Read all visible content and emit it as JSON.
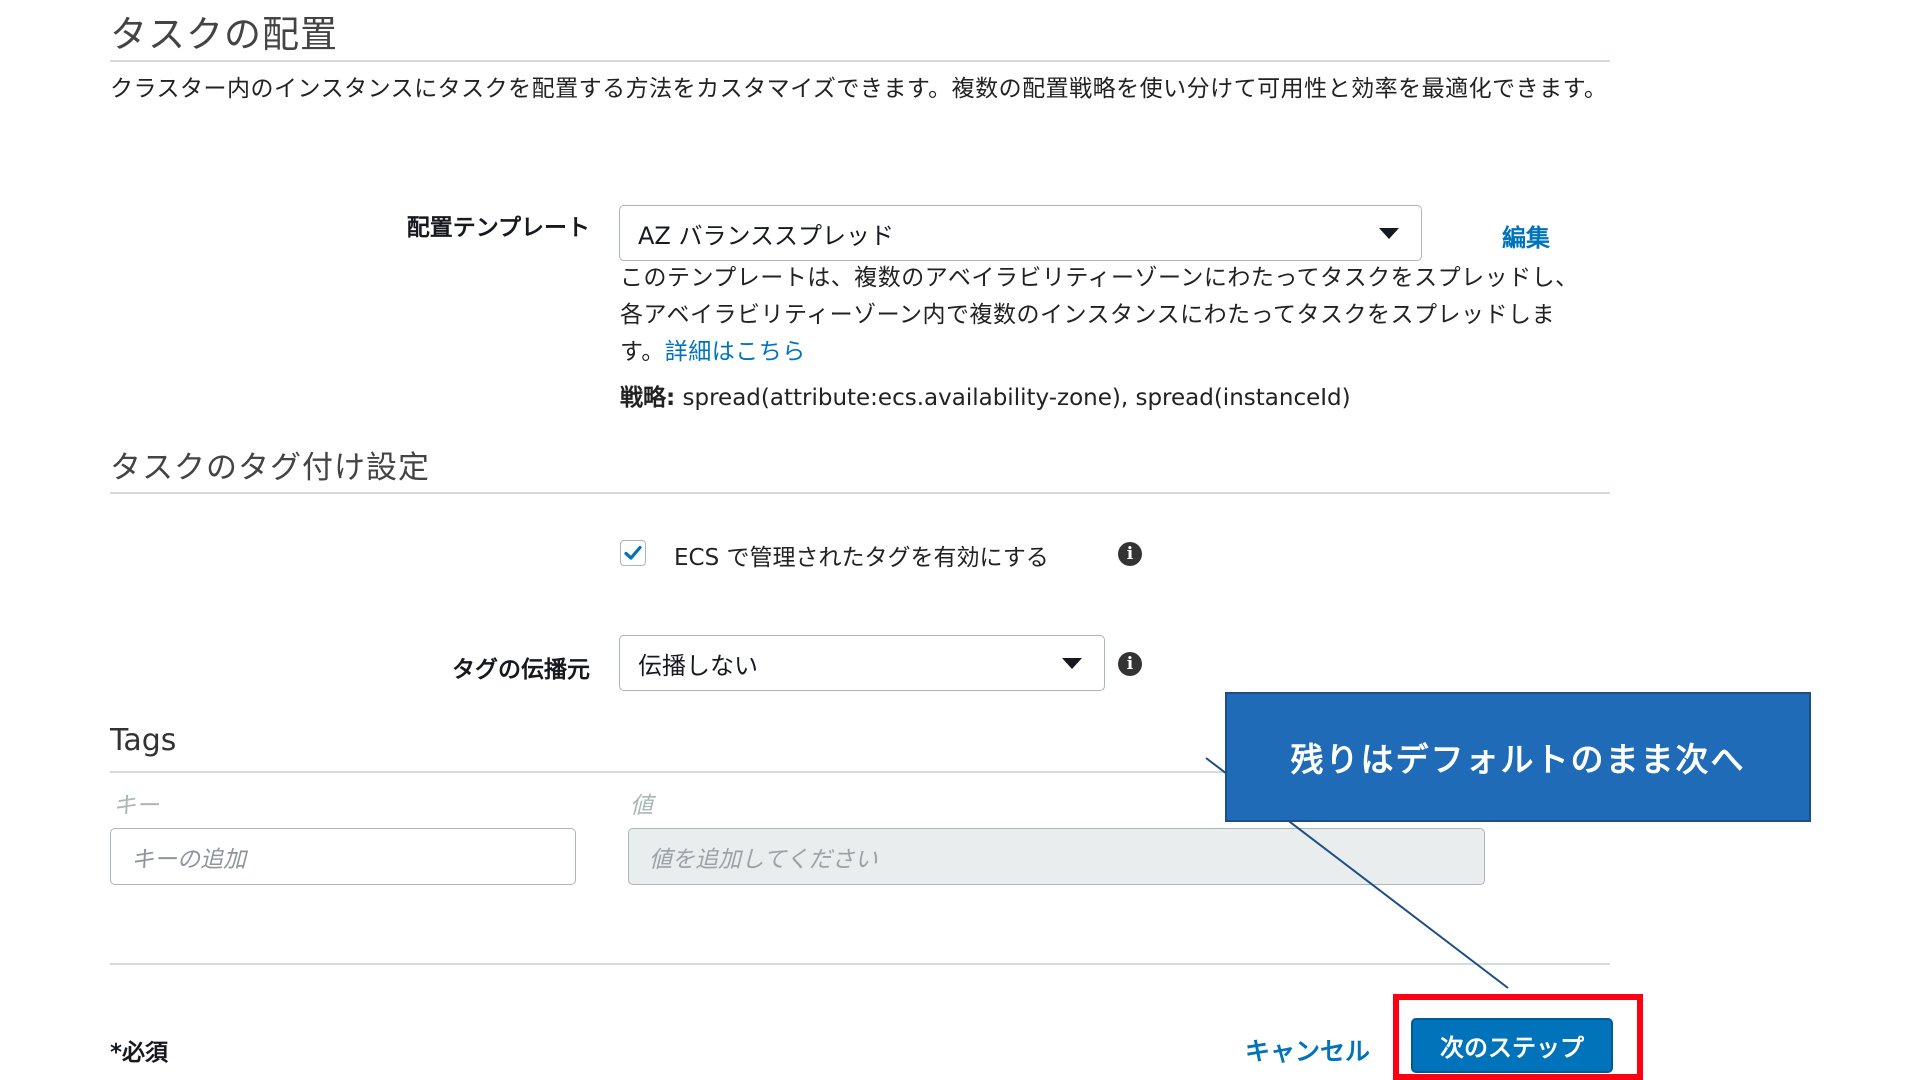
{
  "placement": {
    "title": "タスクの配置",
    "description": "クラスター内のインスタンスにタスクを配置する方法をカスタマイズできます。複数の配置戦略を使い分けて可用性と効率を最適化できます。",
    "template_label": "配置テンプレート",
    "template_value": "AZ バランススプレッド",
    "edit_link": "編集",
    "help_text": "このテンプレートは、複数のアベイラビリティーゾーンにわたってタスクをスプレッドし、各アベイラビリティーゾーン内で複数のインスタンスにわたってタスクをスプレッドします。",
    "learn_more_link": "詳細はこちら",
    "strategy_label": "戦略:",
    "strategy_value": " spread(attribute:ecs.availability-zone), spread(instanceId)"
  },
  "tagging": {
    "title": "タスクのタグ付け設定",
    "ecs_managed_tags_label": "ECS で管理されたタグを有効にする",
    "ecs_managed_tags_checked": true,
    "propagate_label": "タグの伝播元",
    "propagate_value": "伝播しない"
  },
  "tags": {
    "title": "Tags",
    "key_header": "キー",
    "value_header": "値",
    "key_placeholder": "キーの追加",
    "value_placeholder": "値を追加してください"
  },
  "footer": {
    "required_note": "*必須",
    "cancel_label": "キャンセル",
    "next_label": "次のステップ"
  },
  "annotation": {
    "callout_text": "残りはデフォルトのまま次へ",
    "callout_color": "#1f6bb7",
    "highlight_color": "#ff0013"
  },
  "icons": {
    "info": "info-icon",
    "caret": "chevron-down-icon",
    "check": "check-icon"
  },
  "colors": {
    "link": "#0073bb",
    "primary_button": "#0073bb"
  }
}
